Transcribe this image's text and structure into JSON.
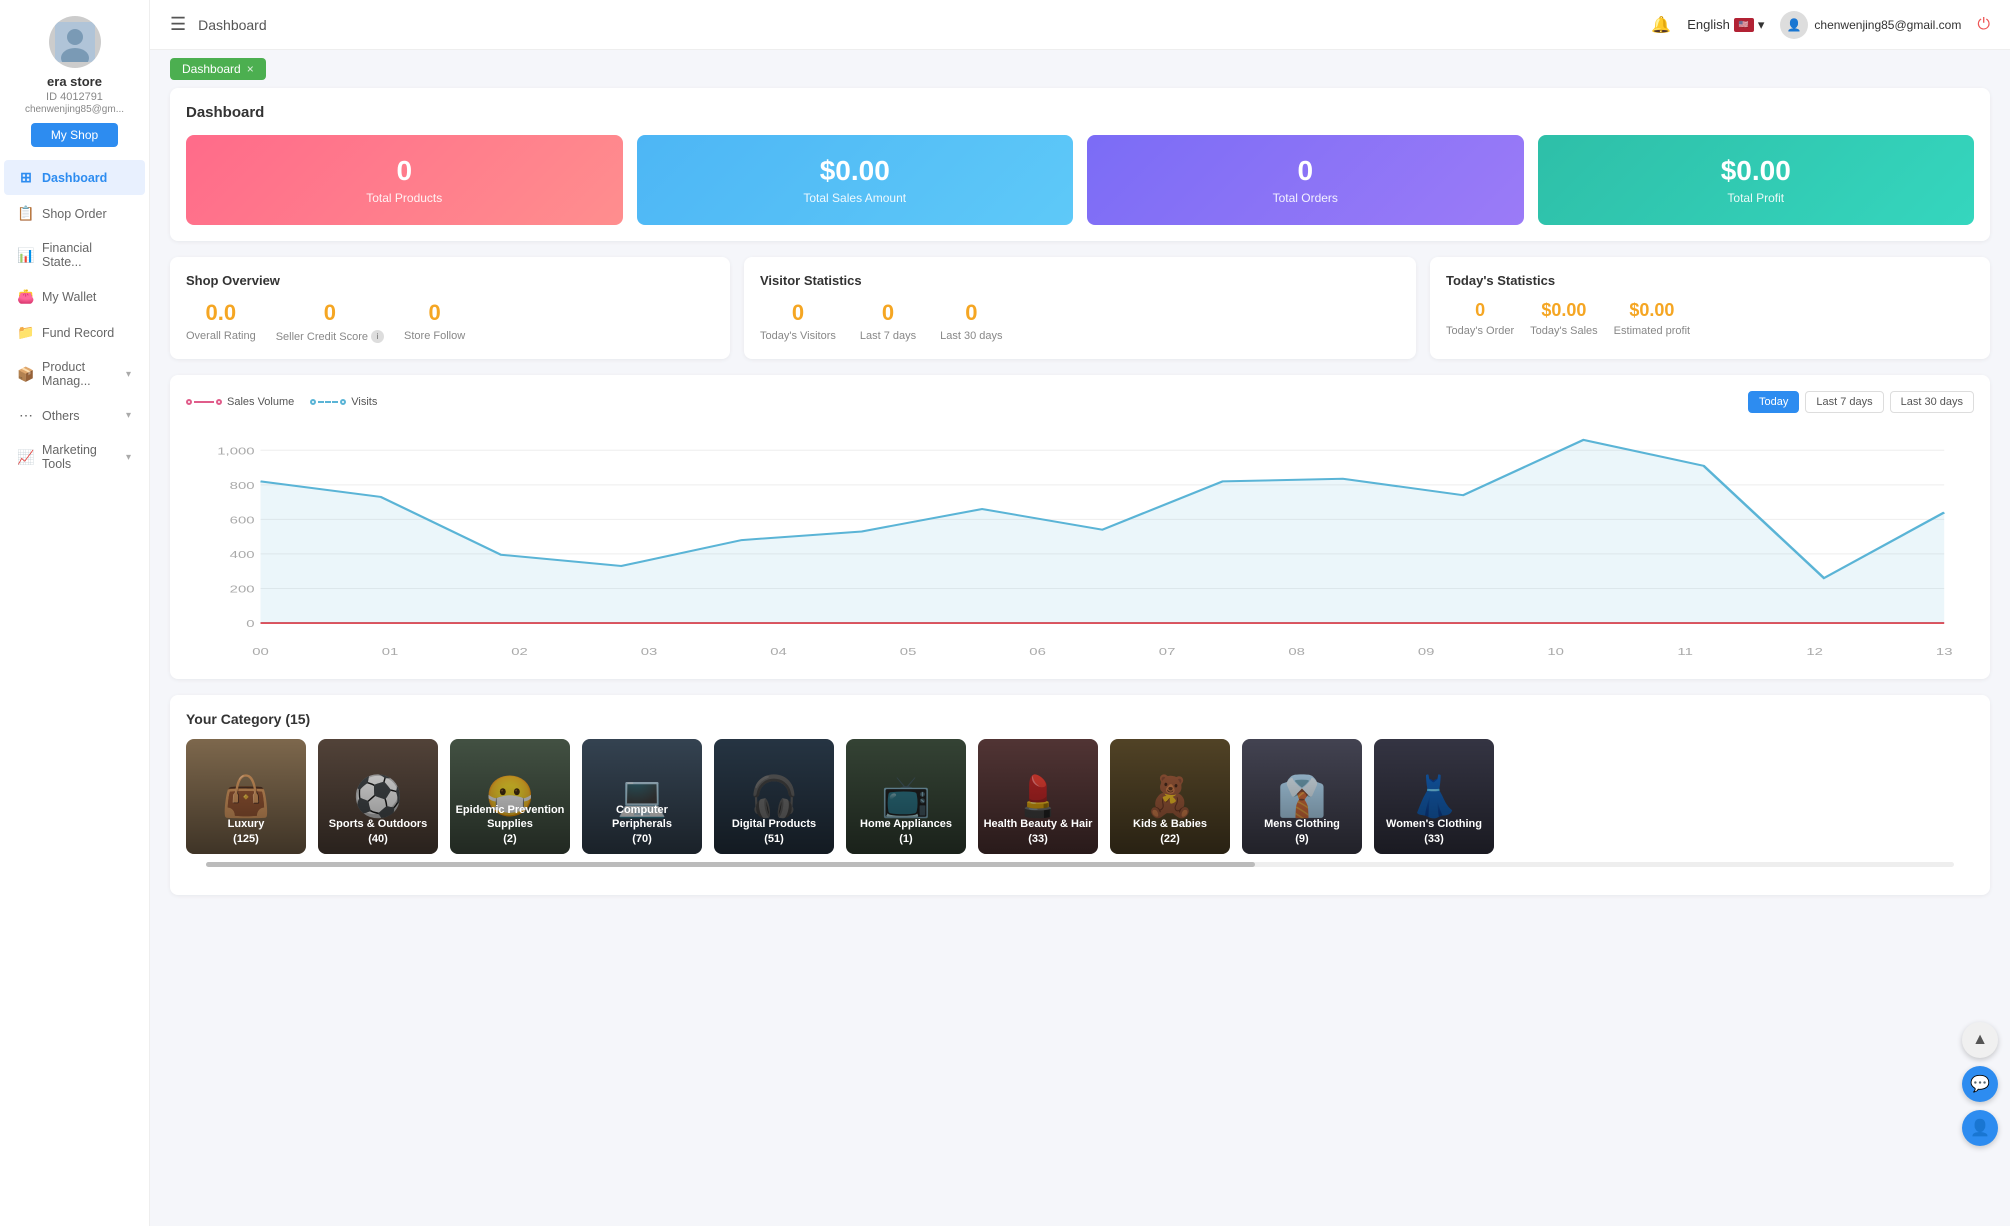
{
  "sidebar": {
    "avatar_emoji": "🏪",
    "store_name": "era store",
    "store_id": "ID 4012791",
    "store_email": "chenwenjing85@gm...",
    "my_shop_label": "My Shop",
    "items": [
      {
        "id": "dashboard",
        "label": "Dashboard",
        "icon": "⊞",
        "active": true,
        "has_arrow": false
      },
      {
        "id": "shop-order",
        "label": "Shop Order",
        "icon": "📋",
        "active": false,
        "has_arrow": false
      },
      {
        "id": "financial-state",
        "label": "Financial State...",
        "icon": "📊",
        "active": false,
        "has_arrow": false
      },
      {
        "id": "my-wallet",
        "label": "My Wallet",
        "icon": "👛",
        "active": false,
        "has_arrow": false
      },
      {
        "id": "fund-record",
        "label": "Fund Record",
        "icon": "📁",
        "active": false,
        "has_arrow": false
      },
      {
        "id": "product-manag",
        "label": "Product Manag...",
        "icon": "📦",
        "active": false,
        "has_arrow": true
      },
      {
        "id": "others",
        "label": "Others",
        "icon": "⋯",
        "active": false,
        "has_arrow": true
      },
      {
        "id": "marketing-tools",
        "label": "Marketing Tools",
        "icon": "📈",
        "active": false,
        "has_arrow": true
      }
    ]
  },
  "topbar": {
    "hamburger": "☰",
    "title": "Dashboard",
    "language": "English",
    "email": "chenwenjing85@gmail.com"
  },
  "breadcrumb": {
    "label": "Dashboard",
    "close": "×"
  },
  "dashboard": {
    "title": "Dashboard",
    "stats": [
      {
        "id": "total-products",
        "value": "0",
        "label": "Total Products",
        "color": "pink"
      },
      {
        "id": "total-sales",
        "value": "$0.00",
        "label": "Total Sales Amount",
        "color": "blue"
      },
      {
        "id": "total-orders",
        "value": "0",
        "label": "Total Orders",
        "color": "purple"
      },
      {
        "id": "total-profit",
        "value": "$0.00",
        "label": "Total Profit",
        "color": "teal"
      }
    ]
  },
  "shop_overview": {
    "title": "Shop Overview",
    "metrics": [
      {
        "id": "overall-rating",
        "value": "0.0",
        "label": "Overall Rating",
        "has_info": false
      },
      {
        "id": "seller-credit",
        "value": "0",
        "label": "Seller Credit Score",
        "has_info": true
      },
      {
        "id": "store-follow",
        "value": "0",
        "label": "Store Follow",
        "has_info": false
      }
    ]
  },
  "visitor_statistics": {
    "title": "Visitor Statistics",
    "metrics": [
      {
        "id": "today-visitors",
        "value": "0",
        "label": "Today's Visitors"
      },
      {
        "id": "last-7-days",
        "value": "0",
        "label": "Last 7 days"
      },
      {
        "id": "last-30-days",
        "value": "0",
        "label": "Last 30 days"
      }
    ]
  },
  "todays_statistics": {
    "title": "Today's Statistics",
    "metrics": [
      {
        "id": "todays-order",
        "value": "0",
        "label": "Today's Order"
      },
      {
        "id": "todays-sales",
        "value": "$0.00",
        "label": "Today's Sales"
      },
      {
        "id": "estimated-profit",
        "value": "$0.00",
        "label": "Estimated profit"
      }
    ]
  },
  "chart": {
    "legend": [
      {
        "id": "sales-volume",
        "label": "Sales Volume",
        "color": "#e05c8a"
      },
      {
        "id": "visits",
        "label": "Visits",
        "color": "#5ab4d6"
      }
    ],
    "buttons": [
      {
        "id": "today",
        "label": "Today",
        "active": true
      },
      {
        "id": "last-7-days",
        "label": "Last 7 days",
        "active": false
      },
      {
        "id": "last-30-days",
        "label": "Last 30 days",
        "active": false
      }
    ],
    "y_labels": [
      "1,000",
      "800",
      "600",
      "400",
      "200",
      "0"
    ],
    "x_labels": [
      "00",
      "01",
      "02",
      "03",
      "04",
      "05",
      "06",
      "07",
      "08",
      "09",
      "10",
      "11",
      "12",
      "13"
    ],
    "visits_points": [
      820,
      730,
      395,
      330,
      480,
      530,
      660,
      540,
      820,
      835,
      740,
      1060,
      910,
      260,
      640
    ]
  },
  "category": {
    "title": "Your Category",
    "count": 15,
    "items": [
      {
        "id": "luxury",
        "label": "Luxury",
        "count": 125,
        "emoji": "👜",
        "bg": "#8B7355"
      },
      {
        "id": "sports-outdoors",
        "label": "Sports & Outdoors",
        "count": 40,
        "emoji": "⚽",
        "bg": "#5B4A3F"
      },
      {
        "id": "epidemic-prevention",
        "label": "Epidemic Prevention Supplies",
        "count": 2,
        "emoji": "😷",
        "bg": "#4A5A4A"
      },
      {
        "id": "computer-peripherals",
        "label": "Computer Peripherals",
        "count": 70,
        "emoji": "💻",
        "bg": "#3A4A5A"
      },
      {
        "id": "digital-products",
        "label": "Digital Products",
        "count": 51,
        "emoji": "🎧",
        "bg": "#2A3A4A"
      },
      {
        "id": "home-appliances",
        "label": "Home Appliances",
        "count": 1,
        "emoji": "📺",
        "bg": "#3A4A3A"
      },
      {
        "id": "health-beauty",
        "label": "Health Beauty & Hair",
        "count": 33,
        "emoji": "💄",
        "bg": "#5A3A3A"
      },
      {
        "id": "kids-babies",
        "label": "Kids & Babies",
        "count": 22,
        "emoji": "🧸",
        "bg": "#5A4A2A"
      },
      {
        "id": "mens-clothing",
        "label": "Mens Clothing",
        "count": 9,
        "emoji": "👔",
        "bg": "#4A4A5A"
      },
      {
        "id": "womens-clothing",
        "label": "Women's Clothing",
        "count": 33,
        "emoji": "👗",
        "bg": "#3A3A4A"
      }
    ]
  }
}
